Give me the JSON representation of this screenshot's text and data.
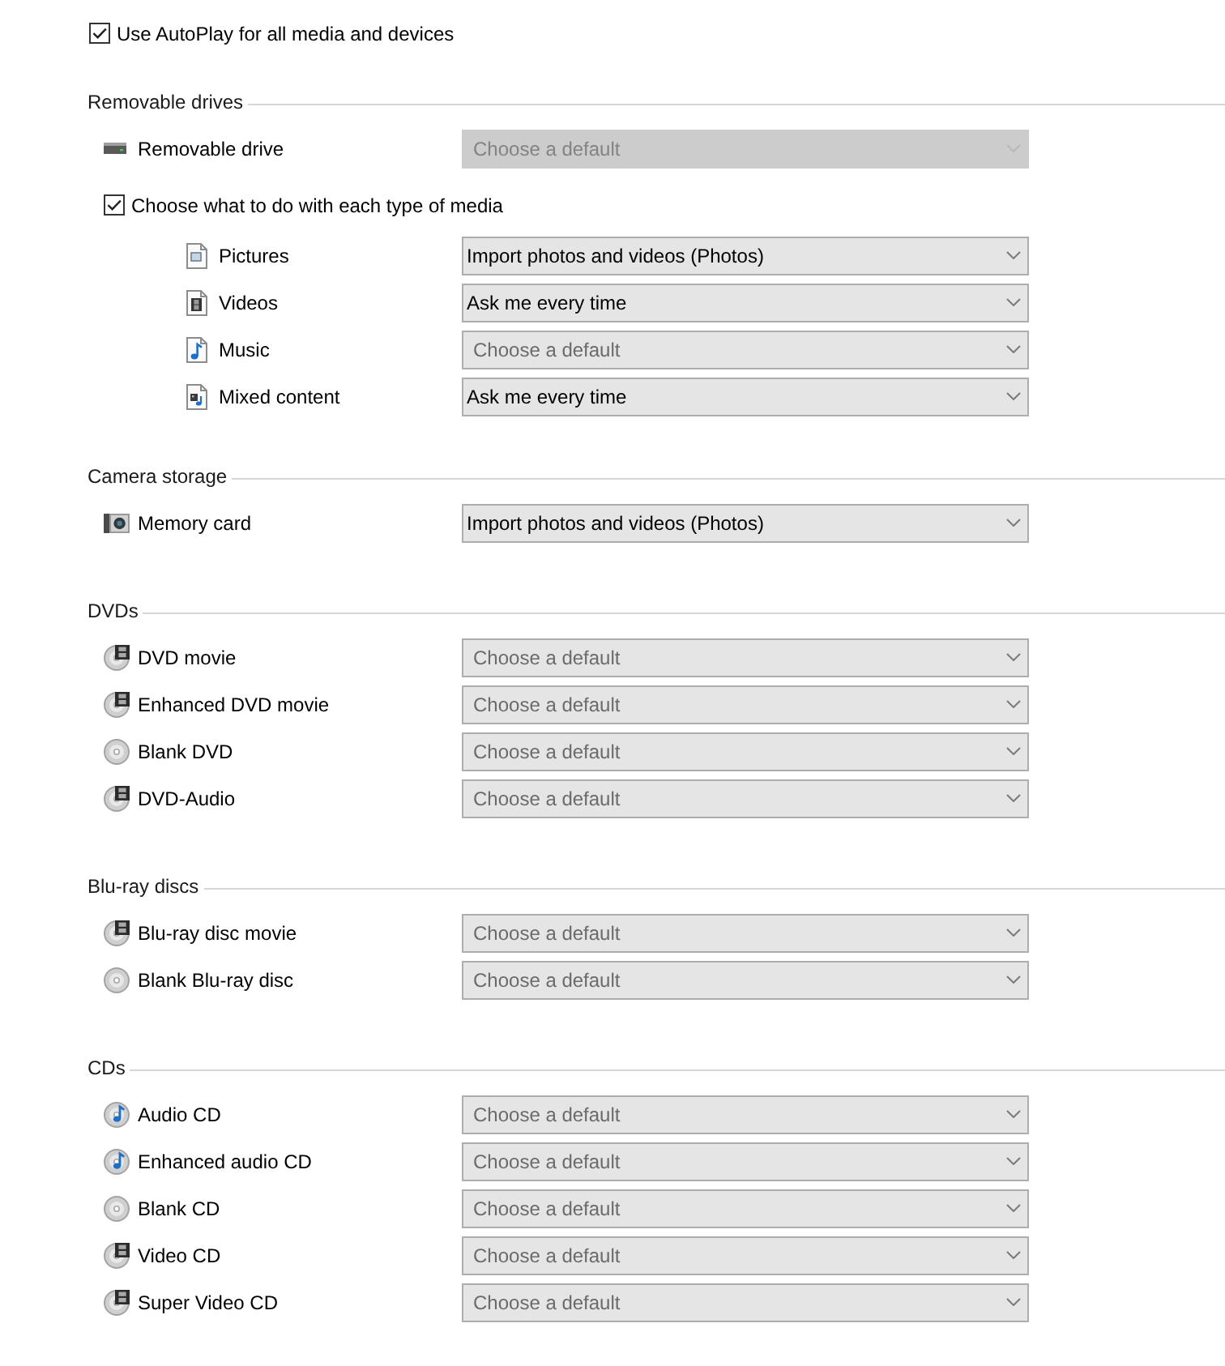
{
  "autoplay": {
    "label": "Use AutoPlay for all media and devices",
    "checked": true
  },
  "sections": [
    {
      "heading": "Removable drives",
      "items": [
        {
          "kind": "drive",
          "label": "Removable drive",
          "dropdown": {
            "placeholder": "Choose a default",
            "disabled": true
          }
        }
      ],
      "media_option": {
        "label": "Choose what to do with each type of media",
        "checked": true,
        "items": [
          {
            "kind": "pictures",
            "label": "Pictures",
            "dropdown": {
              "value": "Import photos and videos (Photos)",
              "disabled": false
            }
          },
          {
            "kind": "videos",
            "label": "Videos",
            "dropdown": {
              "value": "Ask me every time",
              "disabled": false
            }
          },
          {
            "kind": "music",
            "label": "Music",
            "dropdown": {
              "placeholder": "Choose a default",
              "disabled": false
            }
          },
          {
            "kind": "mixed",
            "label": "Mixed content",
            "dropdown": {
              "value": "Ask me every time",
              "disabled": false
            }
          }
        ]
      }
    },
    {
      "heading": "Camera storage",
      "items": [
        {
          "kind": "camera",
          "label": "Memory card",
          "dropdown": {
            "value": "Import photos and videos (Photos)",
            "disabled": false
          }
        }
      ]
    },
    {
      "heading": "DVDs",
      "items": [
        {
          "kind": "film",
          "label": "DVD movie",
          "dropdown": {
            "placeholder": "Choose a default",
            "disabled": false
          }
        },
        {
          "kind": "film",
          "label": "Enhanced DVD movie",
          "dropdown": {
            "placeholder": "Choose a default",
            "disabled": false
          }
        },
        {
          "kind": "blank",
          "label": "Blank DVD",
          "dropdown": {
            "placeholder": "Choose a default",
            "disabled": false
          }
        },
        {
          "kind": "film",
          "label": "DVD-Audio",
          "dropdown": {
            "placeholder": "Choose a default",
            "disabled": false
          }
        }
      ]
    },
    {
      "heading": "Blu-ray discs",
      "items": [
        {
          "kind": "film",
          "label": "Blu-ray disc movie",
          "dropdown": {
            "placeholder": "Choose a default",
            "disabled": false
          }
        },
        {
          "kind": "blank",
          "label": "Blank Blu-ray disc",
          "dropdown": {
            "placeholder": "Choose a default",
            "disabled": false
          }
        }
      ]
    },
    {
      "heading": "CDs",
      "items": [
        {
          "kind": "audio",
          "label": "Audio CD",
          "dropdown": {
            "placeholder": "Choose a default",
            "disabled": false
          }
        },
        {
          "kind": "audio",
          "label": "Enhanced audio CD",
          "dropdown": {
            "placeholder": "Choose a default",
            "disabled": false
          }
        },
        {
          "kind": "blank",
          "label": "Blank CD",
          "dropdown": {
            "placeholder": "Choose a default",
            "disabled": false
          }
        },
        {
          "kind": "film",
          "label": "Video CD",
          "dropdown": {
            "placeholder": "Choose a default",
            "disabled": false
          }
        },
        {
          "kind": "film",
          "label": "Super Video CD",
          "dropdown": {
            "placeholder": "Choose a default",
            "disabled": false
          }
        }
      ]
    }
  ]
}
